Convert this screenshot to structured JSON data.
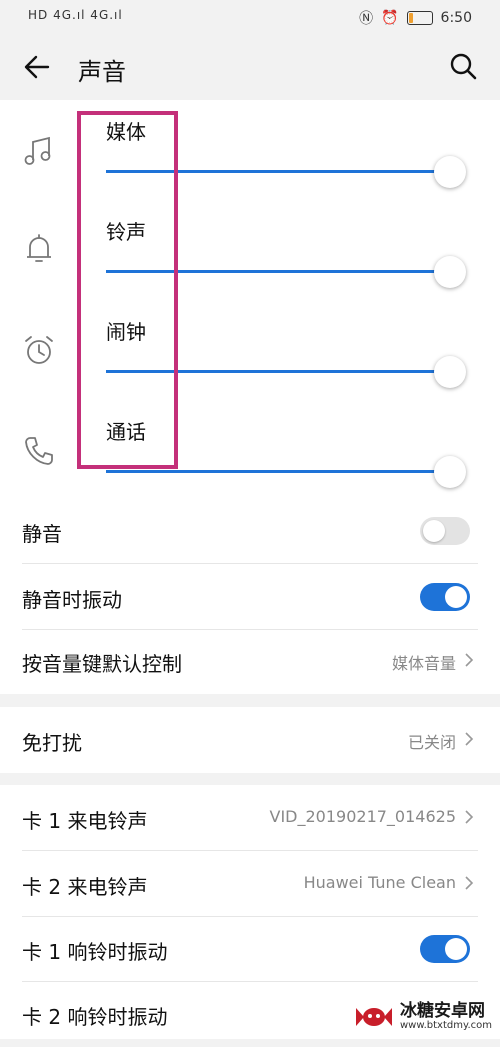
{
  "status_bar": {
    "left_text": "HD 4G.ıl 4G.ıl",
    "time": "6:50",
    "battery_level": 0.2
  },
  "header": {
    "title": "声音",
    "back_icon": "back-arrow-icon",
    "search_icon": "search-icon"
  },
  "volume": {
    "items": [
      {
        "label": "媒体",
        "icon": "music-note-icon",
        "level": 1.0
      },
      {
        "label": "铃声",
        "icon": "bell-icon",
        "level": 1.0
      },
      {
        "label": "闹钟",
        "icon": "alarm-clock-icon",
        "level": 1.0
      },
      {
        "label": "通话",
        "icon": "phone-icon",
        "level": 1.0
      }
    ]
  },
  "settings": {
    "mute": {
      "label": "静音",
      "on": false
    },
    "vibrate_mute": {
      "label": "静音时振动",
      "on": true
    },
    "volume_key": {
      "label": "按音量键默认控制",
      "value": "媒体音量"
    },
    "dnd": {
      "label": "免打扰",
      "value": "已关闭"
    },
    "sim1_ringtone": {
      "label": "卡 1 来电铃声",
      "value": "VID_20190217_014625"
    },
    "sim2_ringtone": {
      "label": "卡 2 来电铃声",
      "value": "Huawei Tune Clean"
    },
    "sim1_vibrate": {
      "label": "卡 1 响铃时振动",
      "on": true
    },
    "sim2_vibrate": {
      "label": "卡 2 响铃时振动"
    }
  },
  "watermark": {
    "line1": "冰糖安卓网",
    "line2": "www.btxtdmy.com"
  },
  "colors": {
    "accent": "#1e73d8",
    "highlight": "#c4307a",
    "background": "#f2f2f2"
  }
}
